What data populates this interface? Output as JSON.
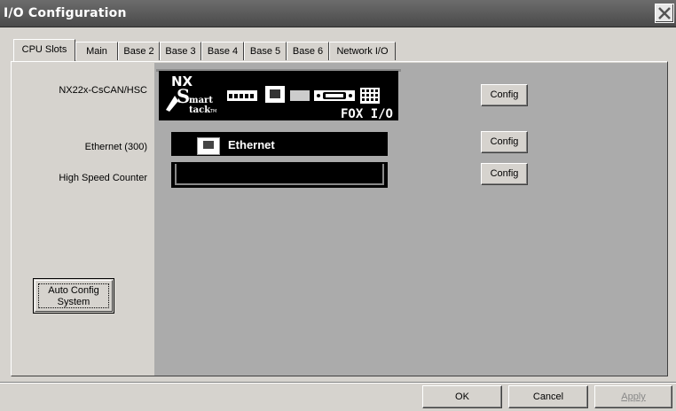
{
  "window": {
    "title": "I/O Configuration"
  },
  "tabs": [
    {
      "label": "CPU Slots",
      "active": true
    },
    {
      "label": "Main"
    },
    {
      "label": "Base 2"
    },
    {
      "label": "Base 3"
    },
    {
      "label": "Base 4"
    },
    {
      "label": "Base 5"
    },
    {
      "label": "Base 6"
    },
    {
      "label": "Network I/O"
    }
  ],
  "slots": [
    {
      "label": "NX22x-CsCAN/HSC",
      "button": "Config"
    },
    {
      "label": "Ethernet (300)",
      "button": "Config",
      "module_text": "Ethernet"
    },
    {
      "label": "High Speed Counter",
      "button": "Config"
    }
  ],
  "card": {
    "brand": "NX",
    "line1": "mart",
    "line2": "tack",
    "tm": "TM",
    "product": "FOX I/O"
  },
  "auto_config": {
    "line1": "Auto Config",
    "line2": "System"
  },
  "footer": {
    "ok": "OK",
    "cancel": "Cancel",
    "apply": "Apply"
  },
  "colors": {
    "titlebar": "#5a5a5a",
    "panel_bg": "#ababab",
    "dialog_bg": "#d6d3ce",
    "module_bg": "#000000"
  }
}
